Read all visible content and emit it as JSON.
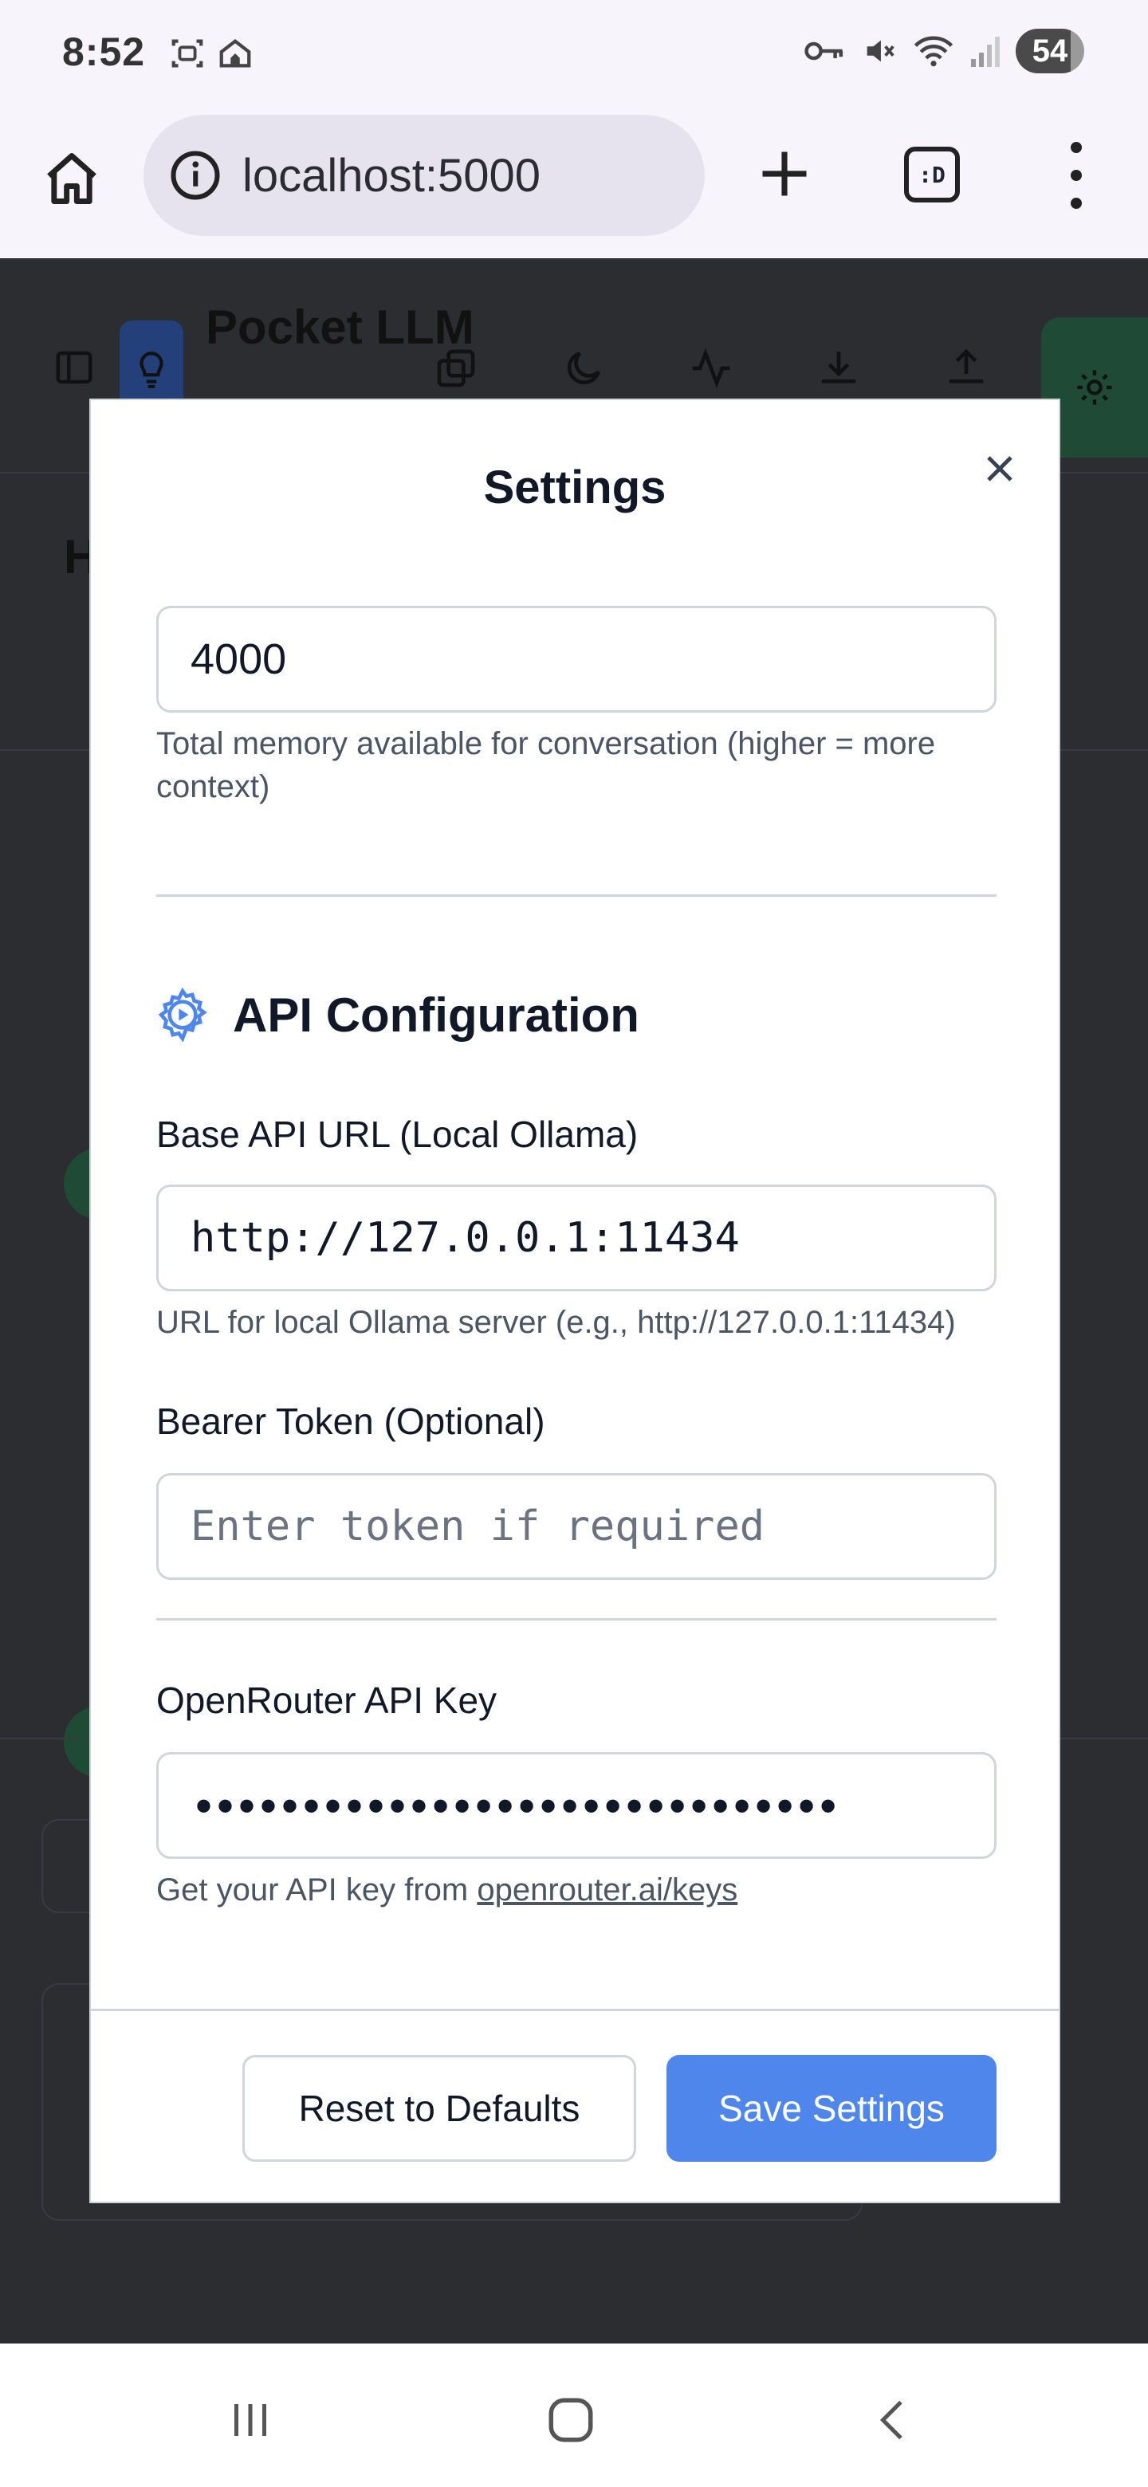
{
  "status_bar": {
    "time": "8:52",
    "battery": "54"
  },
  "browser": {
    "url": "localhost:5000",
    "tabs_label": ":D"
  },
  "background_app": {
    "title": "Pocket LLM",
    "heading_initial": "H"
  },
  "modal": {
    "title": "Settings",
    "memory": {
      "value": "4000",
      "help": "Total memory available for conversation (higher = more context)"
    },
    "api_section": {
      "title": "API Configuration",
      "base_url": {
        "label": "Base API URL (Local Ollama)",
        "value": "http://127.0.0.1:11434",
        "help": "URL for local Ollama server (e.g., http://127.0.0.1:11434)"
      },
      "bearer": {
        "label": "Bearer Token (Optional)",
        "placeholder": "Enter token if required"
      },
      "openrouter": {
        "label": "OpenRouter API Key",
        "masked_value": "••••••••••••••••••••••••••••••",
        "help_prefix": "Get your API key from ",
        "help_link": "openrouter.ai/keys"
      }
    },
    "buttons": {
      "reset": "Reset to Defaults",
      "save": "Save Settings"
    }
  },
  "colors": {
    "accent": "#4f86ec",
    "overlay": "#2c2d31",
    "gear": "#4f86ec"
  },
  "icons": [
    "home-icon",
    "info-icon",
    "plus-icon",
    "tabs-icon",
    "more-vert-icon",
    "close-icon",
    "gear-icon",
    "recents-icon",
    "home-nav-icon",
    "back-icon"
  ]
}
